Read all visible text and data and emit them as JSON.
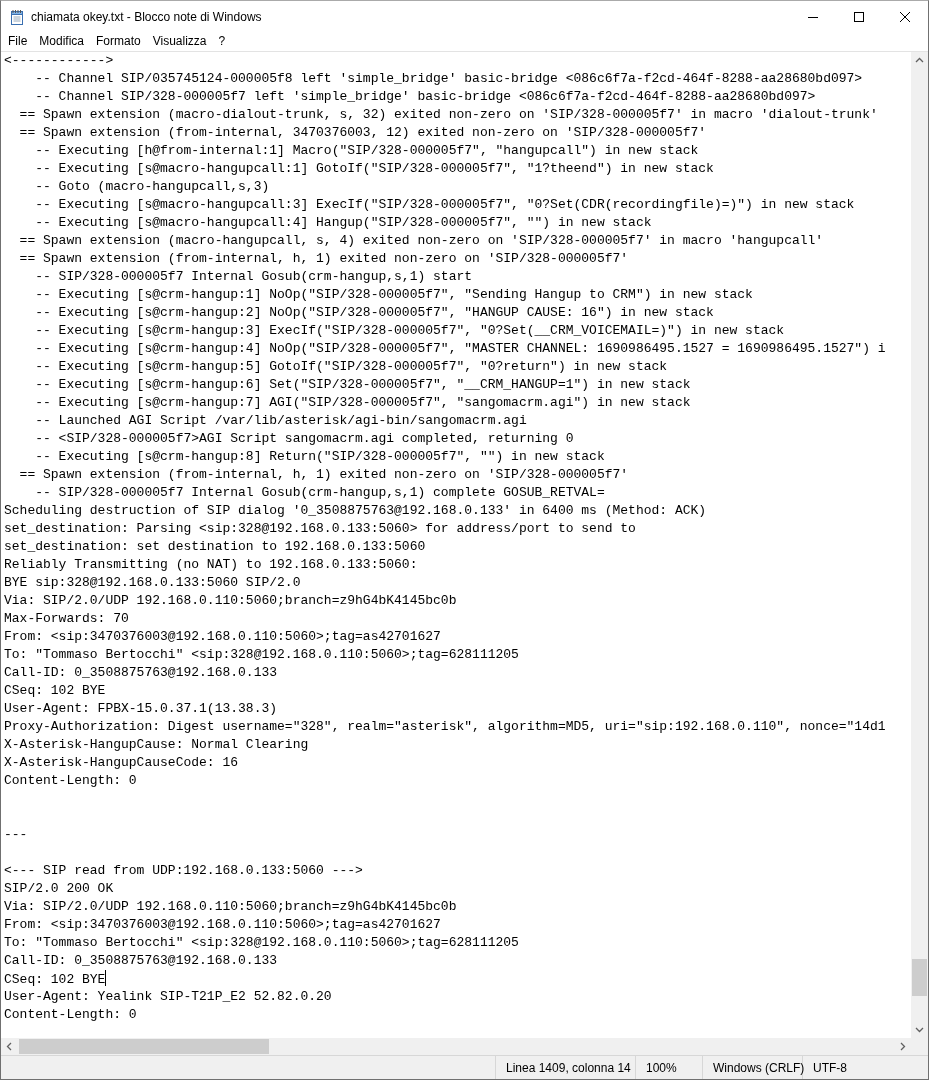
{
  "window": {
    "title": "chiamata okey.txt - Blocco note di Windows"
  },
  "menu": [
    "File",
    "Modifica",
    "Formato",
    "Visualizza",
    "?"
  ],
  "lines": [
    {
      "kind": "text",
      "text": "<------------>"
    },
    {
      "kind": "text",
      "text": "    -- Channel SIP/035745124-000005f8 left 'simple_bridge' basic-bridge <086c6f7a-f2cd-464f-8288-aa28680bd097>"
    },
    {
      "kind": "text",
      "text": "    -- Channel SIP/328-000005f7 left 'simple_bridge' basic-bridge <086c6f7a-f2cd-464f-8288-aa28680bd097>"
    },
    {
      "kind": "text",
      "text": "  == Spawn extension (macro-dialout-trunk, s, 32) exited non-zero on 'SIP/328-000005f7' in macro 'dialout-trunk'"
    },
    {
      "kind": "text",
      "text": "  == Spawn extension (from-internal, 3470376003, 12) exited non-zero on 'SIP/328-000005f7'"
    },
    {
      "kind": "text",
      "text": "    -- Executing [h@from-internal:1] Macro(\"SIP/328-000005f7\", \"hangupcall\") in new stack"
    },
    {
      "kind": "text",
      "text": "    -- Executing [s@macro-hangupcall:1] GotoIf(\"SIP/328-000005f7\", \"1?theend\") in new stack"
    },
    {
      "kind": "text",
      "text": "    -- Goto (macro-hangupcall,s,3)"
    },
    {
      "kind": "text",
      "text": "    -- Executing [s@macro-hangupcall:3] ExecIf(\"SIP/328-000005f7\", \"0?Set(CDR(recordingfile)=)\") in new stack"
    },
    {
      "kind": "text",
      "text": "    -- Executing [s@macro-hangupcall:4] Hangup(\"SIP/328-000005f7\", \"\") in new stack"
    },
    {
      "kind": "text",
      "text": "  == Spawn extension (macro-hangupcall, s, 4) exited non-zero on 'SIP/328-000005f7' in macro 'hangupcall'"
    },
    {
      "kind": "text",
      "text": "  == Spawn extension (from-internal, h, 1) exited non-zero on 'SIP/328-000005f7'"
    },
    {
      "kind": "text",
      "text": "    -- SIP/328-000005f7 Internal Gosub(crm-hangup,s,1) start"
    },
    {
      "kind": "text",
      "text": "    -- Executing [s@crm-hangup:1] NoOp(\"SIP/328-000005f7\", \"Sending Hangup to CRM\") in new stack"
    },
    {
      "kind": "text",
      "text": "    -- Executing [s@crm-hangup:2] NoOp(\"SIP/328-000005f7\", \"HANGUP CAUSE: 16\") in new stack"
    },
    {
      "kind": "text",
      "text": "    -- Executing [s@crm-hangup:3] ExecIf(\"SIP/328-000005f7\", \"0?Set(__CRM_VOICEMAIL=)\") in new stack"
    },
    {
      "kind": "text",
      "text": "    -- Executing [s@crm-hangup:4] NoOp(\"SIP/328-000005f7\", \"MASTER CHANNEL: 1690986495.1527 = 1690986495.1527\") i"
    },
    {
      "kind": "text",
      "text": "    -- Executing [s@crm-hangup:5] GotoIf(\"SIP/328-000005f7\", \"0?return\") in new stack"
    },
    {
      "kind": "text",
      "text": "    -- Executing [s@crm-hangup:6] Set(\"SIP/328-000005f7\", \"__CRM_HANGUP=1\") in new stack"
    },
    {
      "kind": "text",
      "text": "    -- Executing [s@crm-hangup:7] AGI(\"SIP/328-000005f7\", \"sangomacrm.agi\") in new stack"
    },
    {
      "kind": "text",
      "text": "    -- Launched AGI Script /var/lib/asterisk/agi-bin/sangomacrm.agi"
    },
    {
      "kind": "text",
      "text": "    -- <SIP/328-000005f7>AGI Script sangomacrm.agi completed, returning 0"
    },
    {
      "kind": "text",
      "text": "    -- Executing [s@crm-hangup:8] Return(\"SIP/328-000005f7\", \"\") in new stack"
    },
    {
      "kind": "text",
      "text": "  == Spawn extension (from-internal, h, 1) exited non-zero on 'SIP/328-000005f7'"
    },
    {
      "kind": "text",
      "text": "    -- SIP/328-000005f7 Internal Gosub(crm-hangup,s,1) complete GOSUB_RETVAL="
    },
    {
      "kind": "text",
      "text": "Scheduling destruction of SIP dialog '0_3508875763@192.168.0.133' in 6400 ms (Method: ACK)"
    },
    {
      "kind": "text",
      "text": "set_destination: Parsing <sip:328@192.168.0.133:5060> for address/port to send to"
    },
    {
      "kind": "text",
      "text": "set_destination: set destination to 192.168.0.133:5060"
    },
    {
      "kind": "text",
      "text": "Reliably Transmitting (no NAT) to 192.168.0.133:5060:"
    },
    {
      "kind": "text",
      "text": "BYE sip:328@192.168.0.133:5060 SIP/2.0"
    },
    {
      "kind": "text",
      "text": "Via: SIP/2.0/UDP 192.168.0.110:5060;branch=z9hG4bK4145bc0b"
    },
    {
      "kind": "text",
      "text": "Max-Forwards: 70"
    },
    {
      "kind": "text",
      "text": "From: <sip:3470376003@192.168.0.110:5060>;tag=as42701627"
    },
    {
      "kind": "text",
      "text": "To: \"Tommaso Bertocchi\" <sip:328@192.168.0.110:5060>;tag=628111205"
    },
    {
      "kind": "text",
      "text": "Call-ID: 0_3508875763@192.168.0.133"
    },
    {
      "kind": "text",
      "text": "CSeq: 102 BYE"
    },
    {
      "kind": "text",
      "text": "User-Agent: FPBX-15.0.37.1(13.38.3)"
    },
    {
      "kind": "text",
      "text": "Proxy-Authorization: Digest username=\"328\", realm=\"asterisk\", algorithm=MD5, uri=\"sip:192.168.0.110\", nonce=\"14d1"
    },
    {
      "kind": "text",
      "text": "X-Asterisk-HangupCause: Normal Clearing"
    },
    {
      "kind": "text",
      "text": "X-Asterisk-HangupCauseCode: 16"
    },
    {
      "kind": "text",
      "text": "Content-Length: 0"
    },
    {
      "kind": "blank"
    },
    {
      "kind": "blank"
    },
    {
      "kind": "text",
      "text": "---"
    },
    {
      "kind": "blank"
    },
    {
      "kind": "text",
      "text": "<--- SIP read from UDP:192.168.0.133:5060 --->"
    },
    {
      "kind": "text",
      "text": "SIP/2.0 200 OK"
    },
    {
      "kind": "text",
      "text": "Via: SIP/2.0/UDP 192.168.0.110:5060;branch=z9hG4bK4145bc0b"
    },
    {
      "kind": "text",
      "text": "From: <sip:3470376003@192.168.0.110:5060>;tag=as42701627"
    },
    {
      "kind": "text",
      "text": "To: \"Tommaso Bertocchi\" <sip:328@192.168.0.110:5060>;tag=628111205"
    },
    {
      "kind": "text",
      "text": "Call-ID: 0_3508875763@192.168.0.133"
    },
    {
      "kind": "text",
      "text": "CSeq: 102 BYE",
      "caret": true
    },
    {
      "kind": "text",
      "text": "User-Agent: Yealink SIP-T21P_E2 52.82.0.20"
    },
    {
      "kind": "text",
      "text": "Content-Length: 0"
    }
  ],
  "status_bar": {
    "position": "Linea 1409, colonna 14",
    "zoom": "100%",
    "line_ending": "Windows (CRLF)",
    "encoding": "UTF-8"
  }
}
